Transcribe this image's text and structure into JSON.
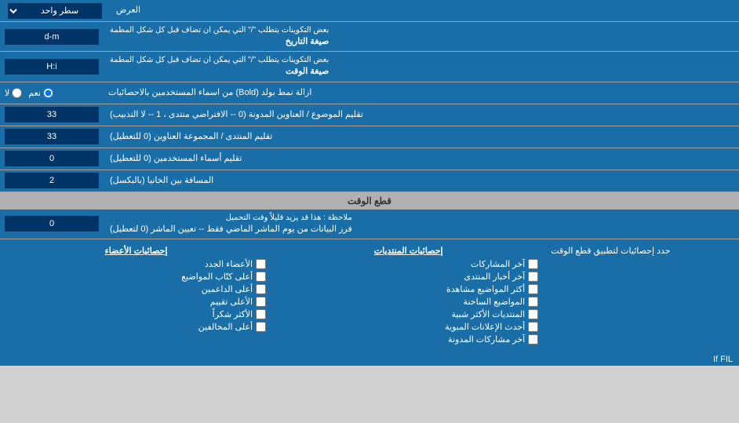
{
  "header": {
    "title": "العرض",
    "select_label": "سطر واحد"
  },
  "rows": [
    {
      "id": "date_format",
      "label": "صيغة التاريخ",
      "sublabel": "بعض التكوينات يتطلب \"/\" التي يمكن ان تضاف قبل كل شكل المطمة",
      "input_value": "d-m",
      "type": "input"
    },
    {
      "id": "time_format",
      "label": "صيغة الوقت",
      "sublabel": "بعض التكوينات يتطلب \"/\" التي يمكن ان تضاف قبل كل شكل المطمة",
      "input_value": "H:i",
      "type": "input"
    },
    {
      "id": "bold_remove",
      "label": "ازالة نمط بولد (Bold) من اسماء المستخدمين بالاحصائيات",
      "radio_options": [
        "نعم",
        "لا"
      ],
      "radio_selected": "نعم",
      "type": "radio"
    },
    {
      "id": "topic_order",
      "label": "تقليم الموضوع / العناوين المدونة (0 -- الافتراضي منتدى ، 1 -- لا التذبيب)",
      "input_value": "33",
      "type": "input"
    },
    {
      "id": "forum_order",
      "label": "تقليم المنتدى / المجموعة العناوين (0 للتعطيل)",
      "input_value": "33",
      "type": "input"
    },
    {
      "id": "user_order",
      "label": "تقليم أسماء المستخدمين (0 للتعطيل)",
      "input_value": "0",
      "type": "input"
    },
    {
      "id": "distance",
      "label": "المسافة بين الخانيا (بالبكسل)",
      "input_value": "2",
      "type": "input"
    }
  ],
  "time_section": {
    "header": "قطع الوقت",
    "row": {
      "label": "فرز البيانات من يوم الماشر الماضي فقط -- تعيين الماشر (0 لتعطيل)",
      "sublabel": "ملاحظة : هذا قد يزيد قليلاً وقت التحميل",
      "input_value": "0"
    },
    "limit_label": "حدد إحصائيات لتطبيق قطع الوقت"
  },
  "checkboxes": {
    "col1_header": "إحصائيات المنتديات",
    "col1_items": [
      {
        "id": "last_posts",
        "label": "آخر المشاركات",
        "checked": false
      },
      {
        "id": "last_news",
        "label": "آخر أخبار المنتدى",
        "checked": false
      },
      {
        "id": "most_viewed",
        "label": "أكثر المواضيع مشاهدة",
        "checked": false
      },
      {
        "id": "hot_topics",
        "label": "المواضيع الساخنة",
        "checked": false
      },
      {
        "id": "similar_forums",
        "label": "المنتديات الأكثر شبية",
        "checked": false
      },
      {
        "id": "recent_ads",
        "label": "أحدث الإعلانات المبوية",
        "checked": false
      },
      {
        "id": "last_noted",
        "label": "آخر مشاركات المدونة",
        "checked": false
      }
    ],
    "col2_header": "إحصائيات الأعضاء",
    "col2_items": [
      {
        "id": "new_members",
        "label": "الأعضاء الجدد",
        "checked": false
      },
      {
        "id": "top_posters",
        "label": "أعلى كتّاب المواضيع",
        "checked": false
      },
      {
        "id": "top_online",
        "label": "أعلى الداعمين",
        "checked": false
      },
      {
        "id": "top_rated",
        "label": "الأعلى تقييم",
        "checked": false
      },
      {
        "id": "most_thanks",
        "label": "الأكثر شكراً",
        "checked": false
      },
      {
        "id": "top_subscribed",
        "label": "أعلى المخالفين",
        "checked": false
      }
    ],
    "col3_label": "If FIL"
  }
}
